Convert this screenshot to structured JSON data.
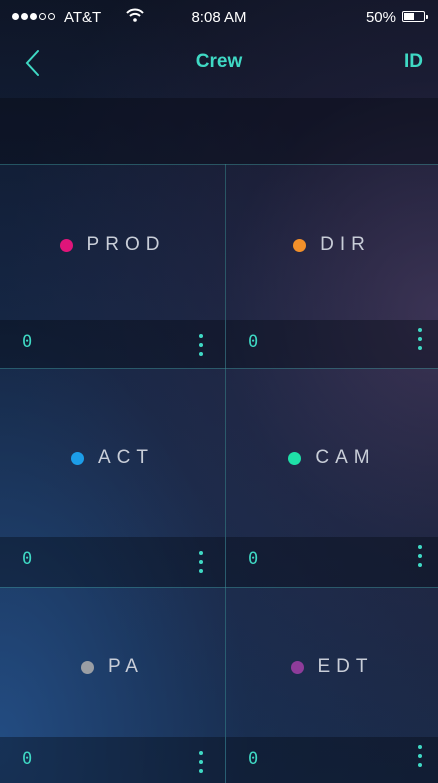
{
  "status": {
    "carrier": "AT&T",
    "time": "8:08 AM",
    "battery_pct": "50%",
    "battery_level": 0.5
  },
  "nav": {
    "title": "Crew",
    "right": "ID",
    "back_icon": "chevron-left-icon"
  },
  "colors": {
    "accent": "#3fd9c4",
    "prod": "#e0157a",
    "dir": "#f2902a",
    "act": "#1c9de8",
    "cam": "#1fe0a8",
    "pa": "#9a9ea4",
    "edt": "#8e3c9a"
  },
  "crew": [
    {
      "label": "PROD",
      "count": "0"
    },
    {
      "label": "DIR",
      "count": "0"
    },
    {
      "label": "ACT",
      "count": "0"
    },
    {
      "label": "CAM",
      "count": "0"
    },
    {
      "label": "PA",
      "count": "0"
    },
    {
      "label": "EDT",
      "count": "0"
    }
  ]
}
